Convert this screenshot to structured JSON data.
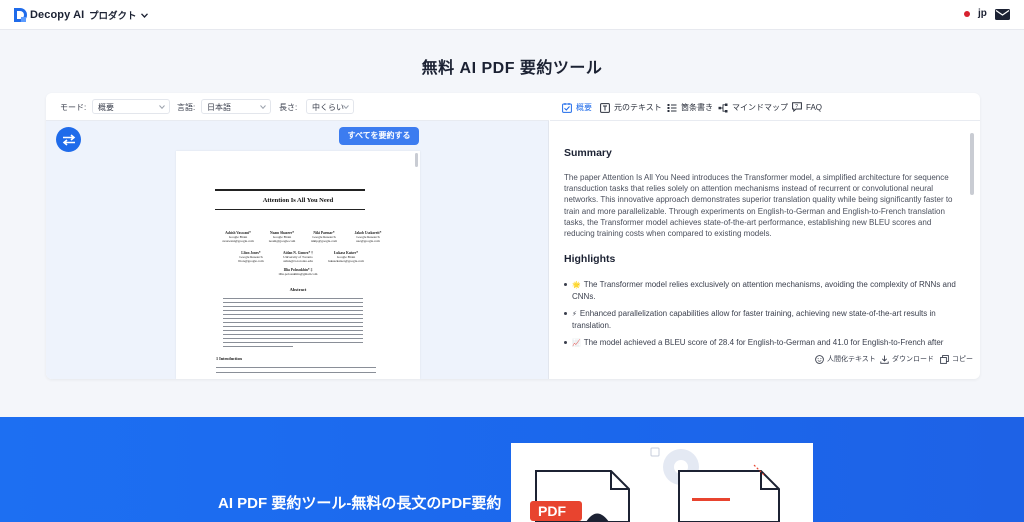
{
  "header": {
    "brand": "Decopy AI",
    "nav_product": "プロダクト",
    "lang": "jp"
  },
  "page_title": "無料 AI PDF 要約ツール",
  "toolbar": {
    "mode_label": "モード:",
    "mode_value": "概要",
    "language_label": "言語:",
    "language_value": "日本語",
    "length_label": "長さ:",
    "length_value": "中くらい",
    "summarize_all": "すべてを要約する"
  },
  "pdf_preview": {
    "title": "Attention Is All You Need",
    "authors": [
      {
        "name": "Ashish Vaswani*",
        "org": "Google Brain",
        "email": "avaswani@google.com"
      },
      {
        "name": "Noam Shazeer*",
        "org": "Google Brain",
        "email": "noam@google.com"
      },
      {
        "name": "Niki Parmar*",
        "org": "Google Research",
        "email": "nikip@google.com"
      },
      {
        "name": "Jakob Uszkoreit*",
        "org": "Google Research",
        "email": "usz@google.com"
      },
      {
        "name": "Llion Jones*",
        "org": "Google Research",
        "email": "llion@google.com"
      },
      {
        "name": "Aidan N. Gomez* †",
        "org": "University of Toronto",
        "email": "aidan@cs.toronto.edu"
      },
      {
        "name": "Łukasz Kaiser*",
        "org": "Google Brain",
        "email": "lukaszkaiser@google.com"
      },
      {
        "name": "Illia Polosukhin* ‡",
        "org": "",
        "email": "illia.polosukhin@gmail.com"
      }
    ],
    "abstract_heading": "Abstract",
    "intro_heading": "1    Introduction"
  },
  "tabs": [
    {
      "label": "概要",
      "icon": "summary-icon",
      "active": true
    },
    {
      "label": "元のテキスト",
      "icon": "text-icon",
      "active": false
    },
    {
      "label": "箇条書き",
      "icon": "list-icon",
      "active": false
    },
    {
      "label": "マインドマップ",
      "icon": "mindmap-icon",
      "active": false
    },
    {
      "label": "FAQ",
      "icon": "faq-icon",
      "active": false
    }
  ],
  "summary": {
    "heading": "Summary",
    "text": "The paper Attention Is All You Need introduces the Transformer model, a simplified architecture for sequence transduction tasks that relies solely on attention mechanisms instead of recurrent or convolutional neural networks. This innovative approach demonstrates superior translation quality while being significantly faster to train and more parallelizable. Through experiments on English-to-German and English-to-French translation tasks, the Transformer model achieves state-of-the-art performance, establishing new BLEU scores and reducing training costs when compared to existing models."
  },
  "highlights": {
    "heading": "Highlights",
    "items": [
      {
        "emoji": "🌟",
        "text": "The Transformer model relies exclusively on attention mechanisms, avoiding the complexity of RNNs and CNNs."
      },
      {
        "emoji": "⚡",
        "text": "Enhanced parallelization capabilities allow for faster training, achieving new state-of-the-art results in translation."
      },
      {
        "emoji": "📈",
        "text": "The model achieved a BLEU score of 28.4 for English-to-German and 41.0 for English-to-French after"
      }
    ]
  },
  "actions": {
    "humanize": "人間化テキスト",
    "download": "ダウンロード",
    "copy": "コピー"
  },
  "banner": {
    "title": "AI PDF 要約ツール-無料の長文のPDF要約"
  },
  "colors": {
    "accent": "#1f6bea",
    "banner": "#1d6ff2"
  }
}
